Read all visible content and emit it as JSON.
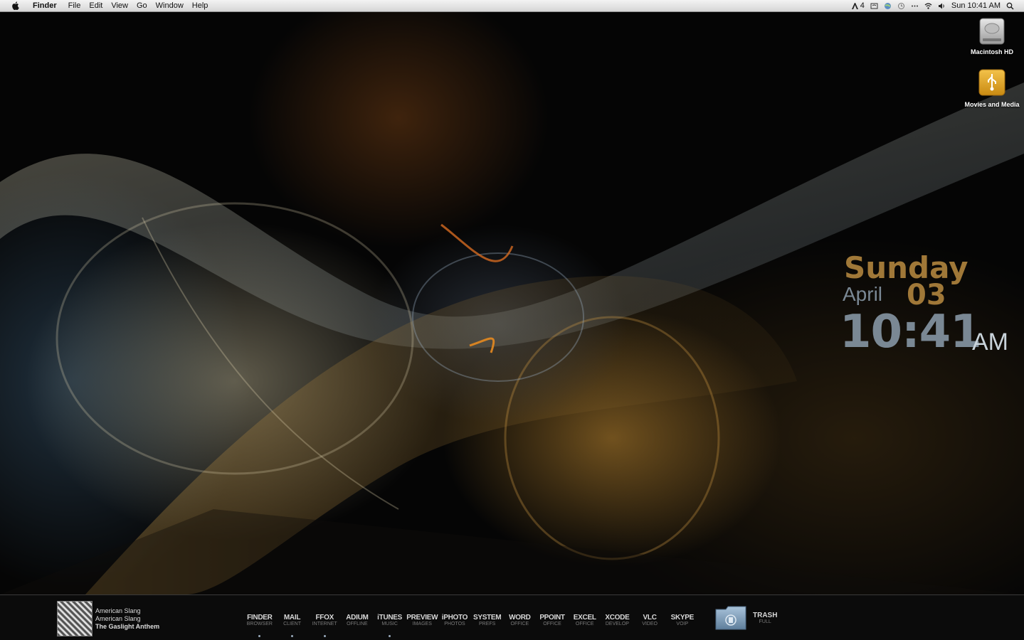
{
  "menubar": {
    "app_name": "Finder",
    "menus": [
      "File",
      "Edit",
      "View",
      "Go",
      "Window",
      "Help"
    ],
    "status_badge": "4",
    "clock": "Sun 10:41 AM"
  },
  "desktop": {
    "icons": [
      {
        "label": "Macintosh HD",
        "icon": "hard-drive-icon"
      },
      {
        "label": "Movies and Media",
        "icon": "usb-drive-icon"
      }
    ]
  },
  "clock_widget": {
    "day": "Sunday",
    "month": "April",
    "date": "03",
    "time": "10:41",
    "ampm": "AM"
  },
  "now_playing": {
    "track": "American Slang",
    "album": "American Slang",
    "artist": "The Gaslight Anthem"
  },
  "dock": {
    "items": [
      {
        "name": "FINDER",
        "sub": "BROWSER",
        "running": true
      },
      {
        "name": "MAIL",
        "sub": "CLIENT",
        "running": true
      },
      {
        "name": "FFOX",
        "sub": "INTERNET",
        "running": true
      },
      {
        "name": "ADIUM",
        "sub": "OFFLINE",
        "running": false
      },
      {
        "name": "iTUNES",
        "sub": "MUSIC",
        "running": true
      },
      {
        "name": "PREVIEW",
        "sub": "IMAGES",
        "running": false
      },
      {
        "name": "iPHOTO",
        "sub": "PHOTOS",
        "running": false
      },
      {
        "name": "SYSTEM",
        "sub": "PREFS",
        "running": false
      },
      {
        "name": "WORD",
        "sub": "OFFICE",
        "running": false
      },
      {
        "name": "PPOINT",
        "sub": "OFFICE",
        "running": false
      },
      {
        "name": "EXCEL",
        "sub": "OFFICE",
        "running": false
      },
      {
        "name": "XCODE",
        "sub": "DEVELOP",
        "running": false
      },
      {
        "name": "VLC",
        "sub": "VIDEO",
        "running": false
      },
      {
        "name": "SKYPE",
        "sub": "VOIP",
        "running": false
      }
    ],
    "trash": {
      "name": "TRASH",
      "sub": "FULL"
    }
  },
  "colors": {
    "clock_gold": "#a07838",
    "clock_slate": "#7a8894"
  }
}
